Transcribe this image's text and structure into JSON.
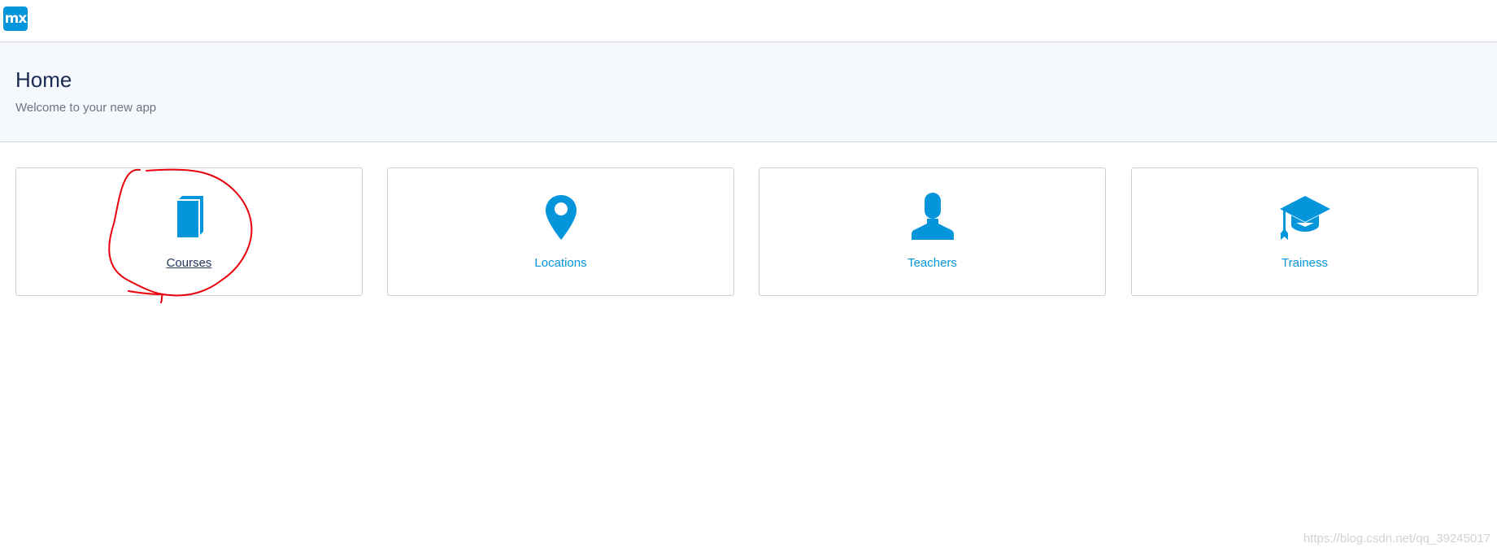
{
  "app": {
    "logo_text": "mx",
    "brand_color": "#0595db"
  },
  "header": {
    "title": "Home",
    "subtitle": "Welcome to your new app"
  },
  "cards": [
    {
      "label": "Courses",
      "icon": "book-icon"
    },
    {
      "label": "Locations",
      "icon": "map-marker-icon"
    },
    {
      "label": "Teachers",
      "icon": "user-icon"
    },
    {
      "label": "Trainess",
      "icon": "graduation-cap-icon"
    }
  ],
  "watermark": "https://blog.csdn.net/qq_39245017",
  "colors": {
    "accent": "#0595db",
    "title": "#1a2a50",
    "header_bg": "#f5f8fd",
    "annotation": "#e8000a"
  }
}
